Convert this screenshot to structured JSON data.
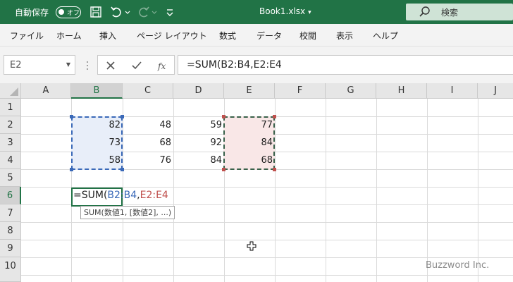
{
  "titlebar": {
    "autosave_label": "自動保存",
    "autosave_state": "オフ",
    "file_name": "Book1.xlsx",
    "search_label": "検索",
    "icons": [
      "save-icon",
      "undo-icon",
      "redo-icon",
      "customize-icon"
    ]
  },
  "ribbon": {
    "tabs": [
      "ファイル",
      "ホーム",
      "挿入",
      "ページ レイアウト",
      "数式",
      "データ",
      "校閲",
      "表示",
      "ヘルプ"
    ]
  },
  "formula_bar": {
    "name_box": "E2",
    "formula": "=SUM(B2:B4,E2:E4",
    "buttons": [
      "cancel-icon",
      "enter-icon",
      "fx-icon"
    ]
  },
  "grid": {
    "columns": [
      "A",
      "B",
      "C",
      "D",
      "E",
      "F",
      "G",
      "H",
      "I",
      "J"
    ],
    "rows": [
      "1",
      "2",
      "3",
      "4",
      "5",
      "6",
      "7",
      "8",
      "9",
      "10"
    ],
    "cells": {
      "B2": "82",
      "C2": "48",
      "D2": "59",
      "E2": "77",
      "B3": "73",
      "C3": "68",
      "D3": "92",
      "E3": "84",
      "B4": "58",
      "C4": "76",
      "D4": "84",
      "E4": "68"
    },
    "editing": {
      "prefix": "=SUM(",
      "ref1": "B2:B4",
      "sep": ",",
      "ref2": "E2:E4"
    },
    "tooltip": "SUM(数値1, [数値2], ...)",
    "range_colors": {
      "first": "#3a69b8",
      "second": "#c0504d"
    }
  },
  "watermark": "Buzzword Inc."
}
